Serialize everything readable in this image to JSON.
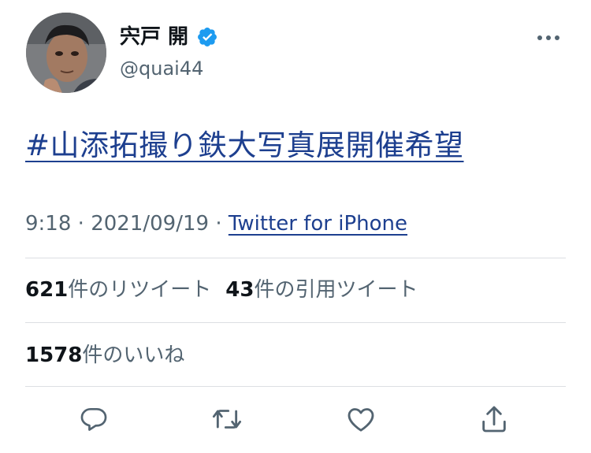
{
  "user": {
    "display_name": "宍戸 開",
    "handle": "@quai44",
    "verified": true
  },
  "tweet": {
    "text": "#山添拓撮り鉄大写真展開催希望",
    "time": "9:18",
    "date": "2021/09/19",
    "separator": "·",
    "source": "Twitter for iPhone"
  },
  "stats": {
    "retweets_count": "621",
    "retweets_label": "件のリツイート",
    "quotes_count": "43",
    "quotes_label": "件の引用ツイート",
    "likes_count": "1578",
    "likes_label": "件のいいね"
  },
  "icons": {
    "verified": "verified-badge-icon",
    "more": "more-options-icon",
    "reply": "reply-icon",
    "retweet": "retweet-icon",
    "like": "heart-icon",
    "share": "share-icon"
  },
  "colors": {
    "link": "#1d3f8f",
    "verified": "#1d9bf0",
    "secondary_text": "#536471",
    "divider": "#dcdfe3"
  }
}
